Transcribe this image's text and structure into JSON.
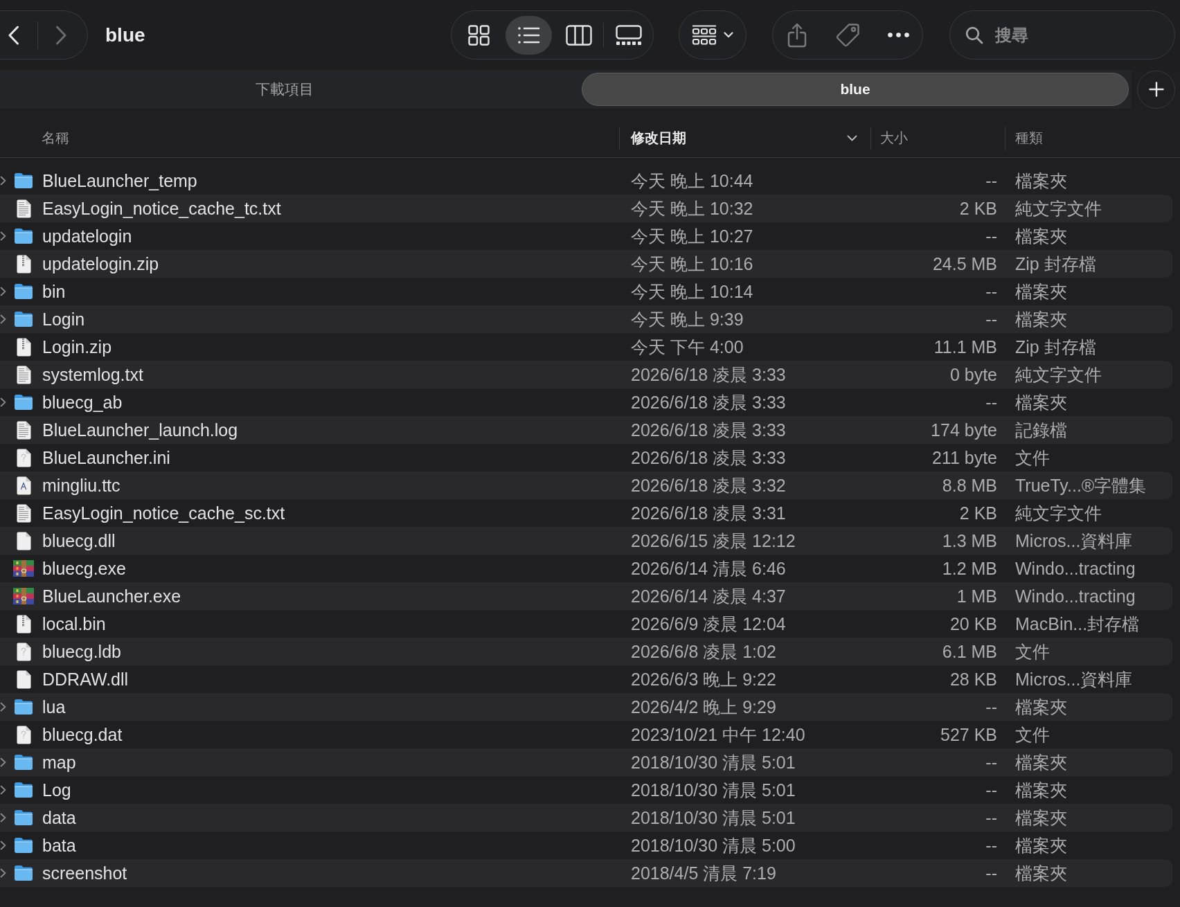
{
  "toolbar": {
    "nav": [
      {
        "kind": "back",
        "disabled": false
      },
      {
        "kind": "forward",
        "disabled": true
      }
    ],
    "title": "blue",
    "view_modes": [
      {
        "kind": "icons",
        "selected": false
      },
      {
        "kind": "list",
        "selected": true
      },
      {
        "kind": "columns",
        "selected": false
      },
      {
        "kind": "gallery",
        "selected": false
      }
    ],
    "actions": [
      {
        "kind": "share",
        "disabled": true
      },
      {
        "kind": "tag",
        "disabled": true
      },
      {
        "kind": "more",
        "disabled": false
      }
    ],
    "search": {
      "placeholder": "搜尋"
    }
  },
  "tabs": [
    {
      "label": "下載項目",
      "selected": false
    },
    {
      "label": "blue",
      "selected": true
    }
  ],
  "table": {
    "columns": [
      {
        "label": "名稱",
        "sorted": false
      },
      {
        "label": "修改日期",
        "sorted": true
      },
      {
        "label": "大小",
        "sorted": false
      },
      {
        "label": "種類",
        "sorted": false
      }
    ],
    "rows": [
      {
        "kind": "folder",
        "expanded": false,
        "name": "BlueLauncher_temp",
        "modified": "今天 晚上 10:44",
        "size": "--",
        "type": "檔案夾"
      },
      {
        "kind": "text",
        "name": "EasyLogin_notice_cache_tc.txt",
        "modified": "今天 晚上 10:32",
        "size": "2 KB",
        "type": "純文字文件"
      },
      {
        "kind": "folder",
        "expanded": false,
        "name": "updatelogin",
        "modified": "今天 晚上 10:27",
        "size": "--",
        "type": "檔案夾"
      },
      {
        "kind": "zip",
        "name": "updatelogin.zip",
        "modified": "今天 晚上 10:16",
        "size": "24.5 MB",
        "type": "Zip 封存檔"
      },
      {
        "kind": "folder",
        "expanded": false,
        "name": "bin",
        "modified": "今天 晚上 10:14",
        "size": "--",
        "type": "檔案夾"
      },
      {
        "kind": "folder",
        "expanded": false,
        "name": "Login",
        "modified": "今天 晚上 9:39",
        "size": "--",
        "type": "檔案夾"
      },
      {
        "kind": "zip",
        "name": "Login.zip",
        "modified": "今天 下午 4:00",
        "size": "11.1 MB",
        "type": "Zip 封存檔"
      },
      {
        "kind": "text",
        "name": "systemlog.txt",
        "modified": "2026/6/18 凌晨 3:33",
        "size": "0 byte",
        "type": "純文字文件"
      },
      {
        "kind": "folder",
        "expanded": false,
        "name": "bluecg_ab",
        "modified": "2026/6/18 凌晨 3:33",
        "size": "--",
        "type": "檔案夾"
      },
      {
        "kind": "text",
        "name": "BlueLauncher_launch.log",
        "modified": "2026/6/18 凌晨 3:33",
        "size": "174 byte",
        "type": "記錄檔"
      },
      {
        "kind": "unknown",
        "name": "BlueLauncher.ini",
        "modified": "2026/6/18 凌晨 3:33",
        "size": "211 byte",
        "type": "文件"
      },
      {
        "kind": "font",
        "name": "mingliu.ttc",
        "modified": "2026/6/18 凌晨 3:32",
        "size": "8.8 MB",
        "type": "TrueTy...®字體集"
      },
      {
        "kind": "text",
        "name": "EasyLogin_notice_cache_sc.txt",
        "modified": "2026/6/18 凌晨 3:31",
        "size": "2 KB",
        "type": "純文字文件"
      },
      {
        "kind": "blank",
        "name": "bluecg.dll",
        "modified": "2026/6/15 凌晨 12:12",
        "size": "1.3 MB",
        "type": "Micros...資料庫"
      },
      {
        "kind": "app",
        "name": "bluecg.exe",
        "modified": "2026/6/14 清晨 6:46",
        "size": "1.2 MB",
        "type": "Windo...tracting"
      },
      {
        "kind": "app",
        "name": "BlueLauncher.exe",
        "modified": "2026/6/14 凌晨 4:37",
        "size": "1 MB",
        "type": "Windo...tracting"
      },
      {
        "kind": "zip",
        "name": "local.bin",
        "modified": "2026/6/9 凌晨 12:04",
        "size": "20 KB",
        "type": "MacBin...封存檔"
      },
      {
        "kind": "unknown",
        "name": "bluecg.ldb",
        "modified": "2026/6/8 凌晨 1:02",
        "size": "6.1 MB",
        "type": "文件"
      },
      {
        "kind": "blank",
        "name": "DDRAW.dll",
        "modified": "2026/6/3 晚上 9:22",
        "size": "28 KB",
        "type": "Micros...資料庫"
      },
      {
        "kind": "folder",
        "expanded": false,
        "name": "lua",
        "modified": "2026/4/2 晚上 9:29",
        "size": "--",
        "type": "檔案夾"
      },
      {
        "kind": "unknown",
        "name": "bluecg.dat",
        "modified": "2023/10/21 中午 12:40",
        "size": "527 KB",
        "type": "文件"
      },
      {
        "kind": "folder",
        "expanded": false,
        "name": "map",
        "modified": "2018/10/30 清晨 5:01",
        "size": "--",
        "type": "檔案夾"
      },
      {
        "kind": "folder",
        "expanded": false,
        "name": "Log",
        "modified": "2018/10/30 清晨 5:01",
        "size": "--",
        "type": "檔案夾"
      },
      {
        "kind": "folder",
        "expanded": false,
        "name": "data",
        "modified": "2018/10/30 清晨 5:01",
        "size": "--",
        "type": "檔案夾"
      },
      {
        "kind": "folder",
        "expanded": false,
        "name": "bata",
        "modified": "2018/10/30 清晨 5:00",
        "size": "--",
        "type": "檔案夾"
      },
      {
        "kind": "folder",
        "expanded": false,
        "name": "screenshot",
        "modified": "2018/4/5 清晨 7:19",
        "size": "--",
        "type": "檔案夾"
      }
    ]
  }
}
